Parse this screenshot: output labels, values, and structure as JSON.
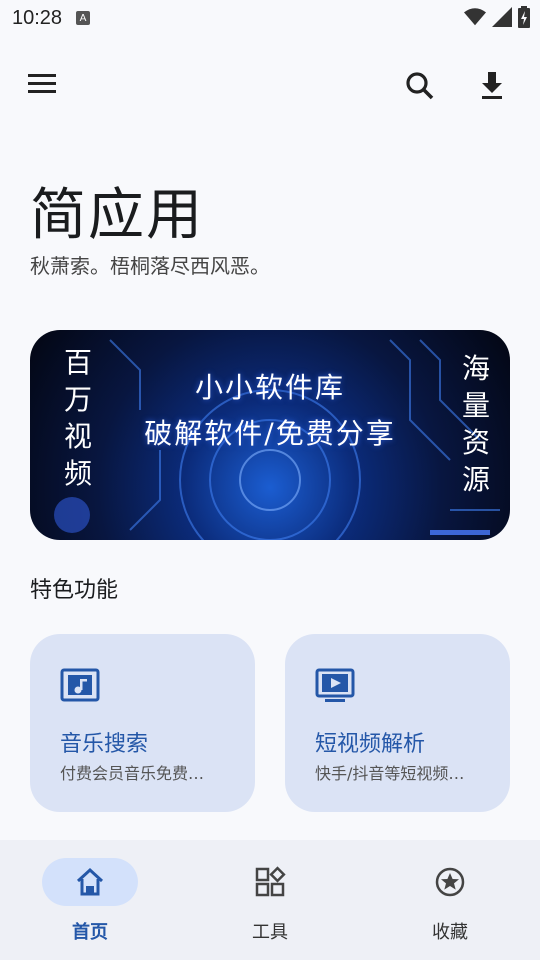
{
  "status_bar": {
    "time": "10:28",
    "keyboard_badge": "A"
  },
  "app": {
    "title": "简应用",
    "subtitle": "秋萧索。梧桐落尽西风恶。"
  },
  "banner": {
    "line1": "小小软件库",
    "line2": "破解软件/免费分享",
    "left_col": [
      "百",
      "万",
      "视",
      "频"
    ],
    "right_col": [
      "海",
      "量",
      "资",
      "源"
    ]
  },
  "section": {
    "title": "特色功能"
  },
  "cards": [
    {
      "title": "音乐搜索",
      "desc": "付费会员音乐免费…",
      "icon": "music-note-icon"
    },
    {
      "title": "短视频解析",
      "desc": "快手/抖音等短视频…",
      "icon": "video-play-icon"
    }
  ],
  "nav": [
    {
      "label": "首页",
      "icon": "home-icon",
      "active": true
    },
    {
      "label": "工具",
      "icon": "tools-grid-icon",
      "active": false
    },
    {
      "label": "收藏",
      "icon": "star-icon",
      "active": false
    }
  ],
  "colors": {
    "accent": "#2457a8",
    "card_bg": "#dbe3f5",
    "nav_active_pill": "#d3e1fb"
  }
}
